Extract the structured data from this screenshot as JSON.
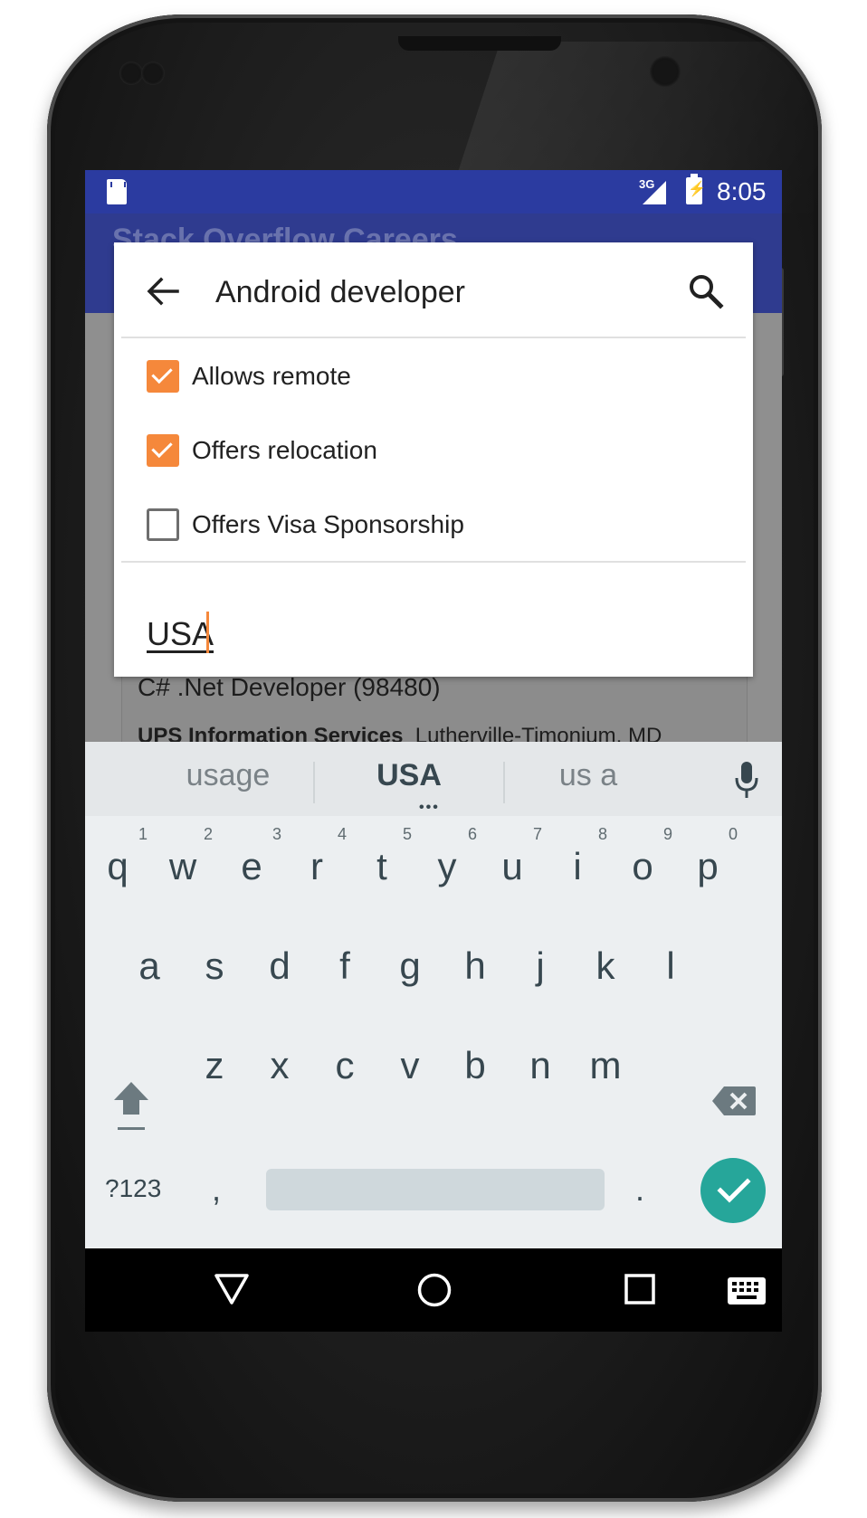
{
  "status_bar": {
    "network": "3G",
    "time": "8:05"
  },
  "app_bar": {
    "title": "Stack Overflow Careers"
  },
  "search": {
    "query": "Android developer",
    "filters": [
      {
        "label": "Allows remote",
        "checked": true
      },
      {
        "label": "Offers relocation",
        "checked": true
      },
      {
        "label": "Offers Visa Sponsorship",
        "checked": false
      }
    ],
    "location": "USA",
    "accent_color": "#f5883b"
  },
  "background_job": {
    "title": "C# .Net Developer (98480)",
    "company": "UPS Information Services",
    "location": "Lutherville-Timonium, MD"
  },
  "keyboard": {
    "suggestions": [
      "usage",
      "USA",
      "us a"
    ],
    "row1": [
      {
        "char": "q",
        "hint": "1"
      },
      {
        "char": "w",
        "hint": "2"
      },
      {
        "char": "e",
        "hint": "3"
      },
      {
        "char": "r",
        "hint": "4"
      },
      {
        "char": "t",
        "hint": "5"
      },
      {
        "char": "y",
        "hint": "6"
      },
      {
        "char": "u",
        "hint": "7"
      },
      {
        "char": "i",
        "hint": "8"
      },
      {
        "char": "o",
        "hint": "9"
      },
      {
        "char": "p",
        "hint": "0"
      }
    ],
    "row2": [
      "a",
      "s",
      "d",
      "f",
      "g",
      "h",
      "j",
      "k",
      "l"
    ],
    "row3": [
      "z",
      "x",
      "c",
      "v",
      "b",
      "n",
      "m"
    ],
    "symbols_label": "?123",
    "comma": ",",
    "period": ".",
    "done_color": "#26a69a"
  },
  "colors": {
    "status_bar": "#2b3ba0",
    "app_bar": "#2f3b8f"
  }
}
